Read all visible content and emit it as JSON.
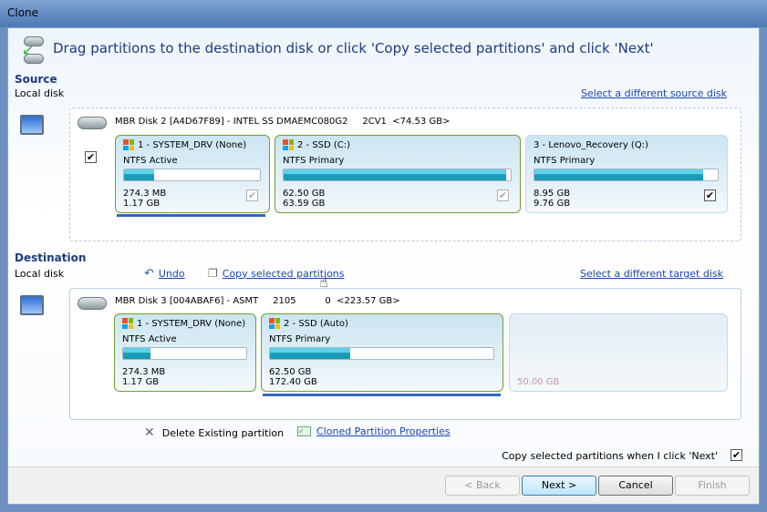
{
  "window": {
    "title": "Clone"
  },
  "header": {
    "instruction": "Drag partitions to the destination disk or click 'Copy selected partitions' and click 'Next'"
  },
  "source": {
    "label": "Source",
    "sublabel": "Local disk",
    "change_link": "Select a different source disk",
    "disk": {
      "title": "MBR Disk 2 [A4D67F89] - INTEL SS DMAEMC080G2     2CV1  <74.53 GB>",
      "checked": true
    },
    "partitions": [
      {
        "name": "1 - SYSTEM_DRV (None)",
        "type": "NTFS Active",
        "used": "274.3 MB",
        "total": "1.17 GB",
        "used_pct": 22,
        "checked": true,
        "enabled": false,
        "windows_icon": true
      },
      {
        "name": "2 - SSD (C:)",
        "type": "NTFS Primary",
        "used": "62.50 GB",
        "total": "63.59 GB",
        "used_pct": 98,
        "checked": true,
        "enabled": false,
        "windows_icon": true
      },
      {
        "name": "3 - Lenovo_Recovery (Q:)",
        "type": "NTFS Primary",
        "used": "8.95 GB",
        "total": "9.76 GB",
        "used_pct": 92,
        "checked": true,
        "enabled": true,
        "windows_icon": false
      }
    ]
  },
  "destination": {
    "label": "Destination",
    "sublabel": "Local disk",
    "undo": "Undo",
    "copy_selected": "Copy selected partitions",
    "change_link": "Select a different target disk",
    "disk": {
      "title": "MBR Disk 3 [004ABAF6] - ASMT     2105          0  <223.57 GB>"
    },
    "partitions": [
      {
        "name": "1 - SYSTEM_DRV (None)",
        "type": "NTFS Active",
        "used": "274.3 MB",
        "total": "1.17 GB",
        "used_pct": 22
      },
      {
        "name": "2 - SSD (Auto)",
        "type": "NTFS Primary",
        "used": "62.50 GB",
        "total": "172.40 GB",
        "used_pct": 36
      }
    ],
    "unallocated": "50.00 GB"
  },
  "actions": {
    "delete_existing": "Delete Existing partition",
    "cloned_properties": "Cloned Partition Properties"
  },
  "option": {
    "label": "Copy selected partitions when I click 'Next'",
    "checked": true
  },
  "buttons": {
    "back": "< Back",
    "next": "Next >",
    "cancel": "Cancel",
    "finish": "Finish"
  }
}
